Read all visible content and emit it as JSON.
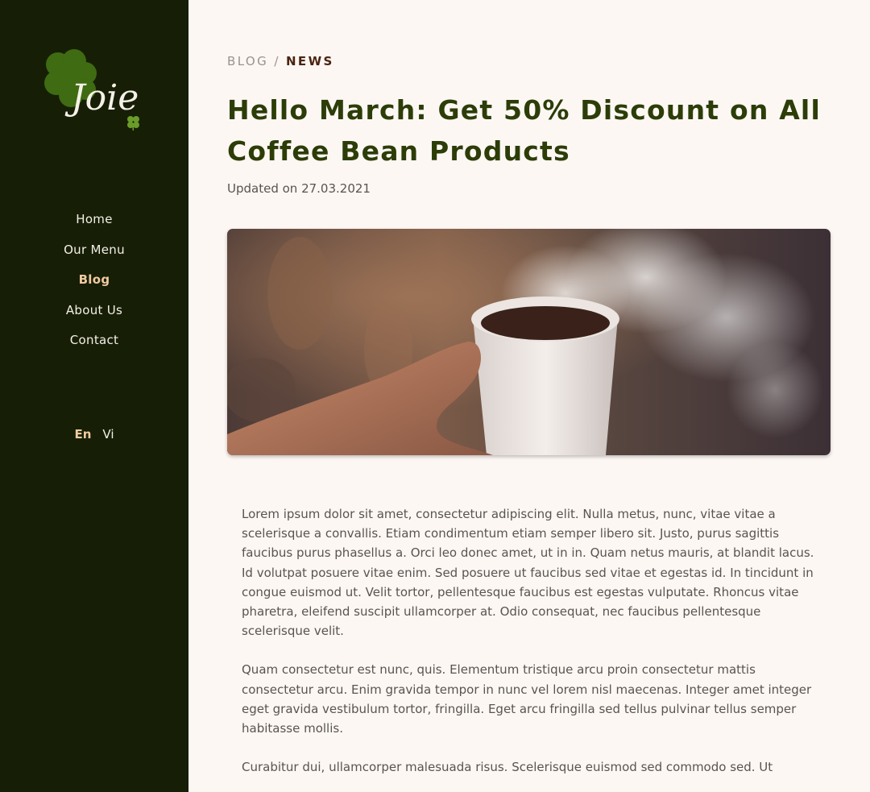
{
  "brand": {
    "logo_text": "Joie"
  },
  "nav": {
    "items": [
      {
        "label": "Home"
      },
      {
        "label": "Our Menu"
      },
      {
        "label": "Blog"
      },
      {
        "label": "About Us"
      },
      {
        "label": "Contact"
      }
    ],
    "active_index": 2
  },
  "languages": {
    "items": [
      {
        "label": "En"
      },
      {
        "label": "Vi"
      }
    ],
    "active_index": 0
  },
  "breadcrumb": {
    "parent": "BLOG",
    "separator": "/",
    "current": "NEWS"
  },
  "post": {
    "title": "Hello March: Get 50% Discount on All Coffee Bean Products",
    "updated": "Updated on 27.03.2021",
    "paragraphs": [
      "Lorem ipsum dolor sit amet, consectetur adipiscing elit. Nulla metus, nunc, vitae vitae a scelerisque a convallis. Etiam condimentum etiam semper libero sit. Justo, purus sagittis faucibus purus phasellus a. Orci leo donec amet, ut in in. Quam netus mauris, at blandit lacus. Id volutpat posuere vitae enim. Sed posuere ut faucibus sed vitae et egestas id. In tincidunt in congue euismod ut. Velit tortor, pellentesque faucibus est egestas vulputate. Rhoncus vitae pharetra, eleifend suscipit ullamcorper at. Odio consequat, nec faucibus pellentesque scelerisque velit.",
      "Quam consectetur est nunc, quis. Elementum tristique arcu proin consectetur mattis consectetur arcu. Enim gravida tempor in nunc vel lorem nisl maecenas. Integer amet integer eget gravida vestibulum tortor, fringilla. Eget arcu fringilla sed tellus pulvinar tellus semper habitasse mollis.",
      "Curabitur dui, ullamcorper malesuada risus. Scelerisque euismod sed commodo sed. Ut"
    ]
  },
  "colors": {
    "sidebar_bg": "#161f06",
    "page_bg": "#fdf7f4",
    "accent": "#f2c9a1",
    "title": "#2c3d08",
    "breadcrumb_current": "#4a2412",
    "logo_green": "#3f6b12"
  },
  "icons": {
    "logo": "four-leaf-clover-icon"
  }
}
